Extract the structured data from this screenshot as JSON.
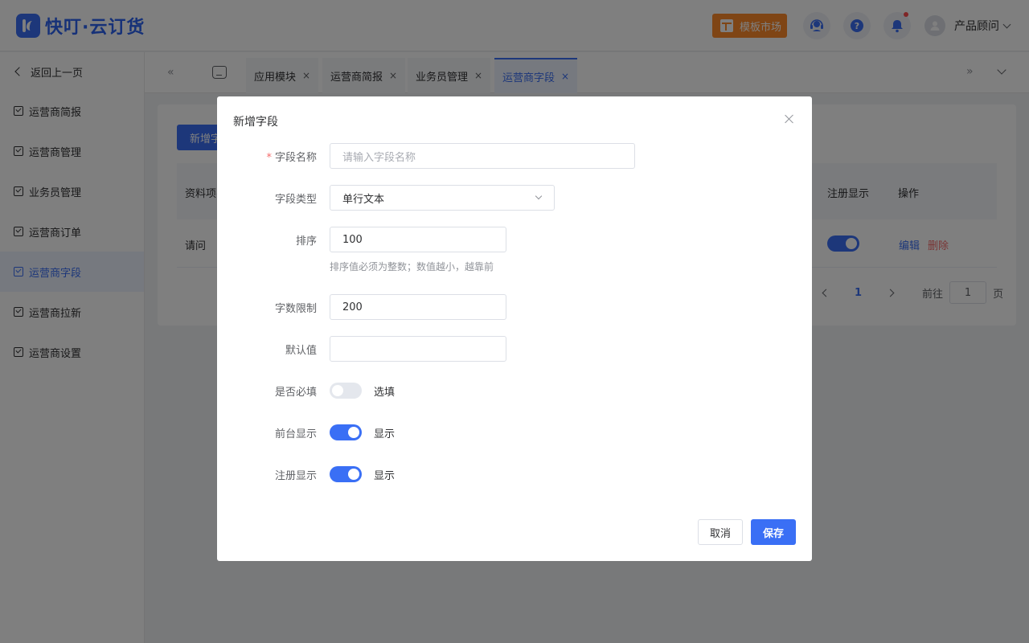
{
  "header": {
    "logo_text": "快叮·云订货",
    "market_label": "模板市场",
    "user_name": "产品顾问",
    "icons": [
      "service-icon",
      "help-icon",
      "bell-icon",
      "avatar-icon"
    ],
    "has_notification": true
  },
  "sidebar": {
    "back_label": "返回上一页",
    "items": [
      {
        "label": "运营商简报"
      },
      {
        "label": "运营商管理"
      },
      {
        "label": "业务员管理"
      },
      {
        "label": "运营商订单"
      },
      {
        "label": "运营商字段",
        "active": true
      },
      {
        "label": "运营商拉新"
      },
      {
        "label": "运营商设置"
      }
    ]
  },
  "tabs": {
    "prev_label": "«",
    "next_label": "»",
    "items": [
      {
        "label": "应用模块"
      },
      {
        "label": "运营商简报"
      },
      {
        "label": "业务员管理"
      },
      {
        "label": "运营商字段",
        "active": true
      }
    ],
    "close_glyph": "×"
  },
  "content": {
    "add_button": "新增字段",
    "columns": [
      "资料项名",
      "注册显示",
      "操作"
    ],
    "rows": [
      {
        "name": "请问",
        "register_show": true,
        "edit": "编辑",
        "delete": "删除"
      }
    ],
    "pager": {
      "current": "1",
      "goto_label": "前往",
      "goto_value": "1",
      "page_suffix": "页"
    }
  },
  "modal": {
    "title": "新增字段",
    "fields": {
      "name": {
        "label": "字段名称",
        "required": true,
        "required_mark": "*",
        "placeholder": "请输入字段名称",
        "value": ""
      },
      "type": {
        "label": "字段类型",
        "value": "单行文本"
      },
      "sort": {
        "label": "排序",
        "value": "100",
        "hint": "排序值必须为整数；数值越小，越靠前"
      },
      "limit": {
        "label": "字数限制",
        "value": "200"
      },
      "default": {
        "label": "默认值",
        "value": ""
      },
      "required_toggle": {
        "label": "是否必填",
        "on": false,
        "text": "选填"
      },
      "front_show": {
        "label": "前台显示",
        "on": true,
        "text": "显示"
      },
      "register_show": {
        "label": "注册显示",
        "on": true,
        "text": "显示"
      }
    },
    "cancel_label": "取消",
    "save_label": "保存"
  },
  "colors": {
    "primary": "#3a6ff5",
    "market": "#ff8a2a",
    "danger": "#f56c6c",
    "overlay": "rgba(0,0,0,0.5)"
  }
}
